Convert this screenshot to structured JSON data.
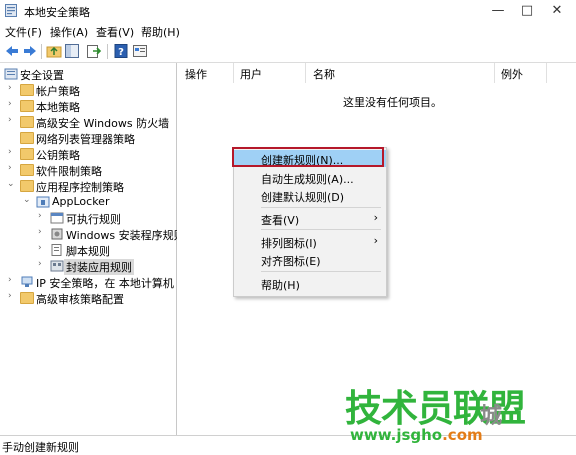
{
  "window": {
    "title": "本地安全策略",
    "controls": [
      "—",
      "□",
      "✕"
    ]
  },
  "menu": [
    "文件(F)",
    "操作(A)",
    "查看(V)",
    "帮助(H)"
  ],
  "toolbar": {
    "icons": [
      "back-icon",
      "forward-icon",
      "up-folder-icon",
      "show-tree-icon",
      "export-icon",
      "help-icon",
      "properties-icon"
    ]
  },
  "tree": {
    "items": [
      {
        "label": "安全设置",
        "expanded": true
      },
      {
        "label": "帐户策略"
      },
      {
        "label": "本地策略"
      },
      {
        "label": "高级安全 Windows 防火墙"
      },
      {
        "label": "网络列表管理器策略"
      },
      {
        "label": "公钥策略"
      },
      {
        "label": "软件限制策略"
      },
      {
        "label": "应用程序控制策略",
        "expanded": true
      },
      {
        "label": "AppLocker",
        "expanded": true
      },
      {
        "label": "可执行规则"
      },
      {
        "label": "Windows 安装程序规则"
      },
      {
        "label": "脚本规则"
      },
      {
        "label": "封装应用规则",
        "selected": true
      },
      {
        "label": "IP 安全策略，在 本地计算机"
      },
      {
        "label": "高级审核策略配置"
      }
    ]
  },
  "list": {
    "columns": [
      "操作",
      "用户",
      "名称",
      "例外"
    ],
    "empty_message": "这里没有任何项目。"
  },
  "context_menu": {
    "items": [
      {
        "label": "创建新规则(N)...",
        "highlighted": true
      },
      {
        "label": "自动生成规则(A)..."
      },
      {
        "label": "创建默认规则(D)"
      },
      {
        "label": "查看(V)",
        "submenu": true
      },
      {
        "label": "排列图标(I)",
        "submenu": true
      },
      {
        "label": "对齐图标(E)"
      },
      {
        "label": "帮助(H)"
      }
    ],
    "submenu_arrow": "›"
  },
  "status": {
    "text": "手动创建新规则"
  },
  "watermark": {
    "text": "技术员联盟",
    "url_prefix": "www.",
    "url_domain": "jsgho",
    "url_suffix": ".com",
    "city_text": "城",
    "com_text": "com"
  },
  "colors": {
    "highlight": "#9fd0f5",
    "red_box": "#b5182a",
    "watermark_green": "#31b43c"
  }
}
